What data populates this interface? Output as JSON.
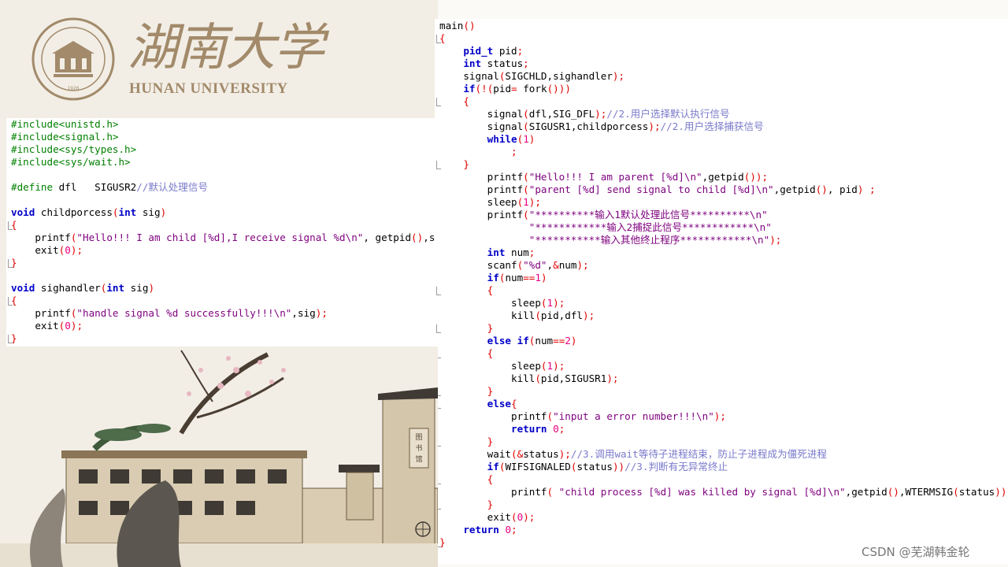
{
  "logo": {
    "chinese_name": "湖南大学",
    "english_name": "HUNAN UNIVERSITY"
  },
  "left_code": {
    "lines": [
      "#include<unistd.h>",
      "#include<signal.h>",
      "#include<sys/types.h>",
      "#include<sys/wait.h>",
      "",
      "#define dfl   SIGUSR2//默认处理信号",
      "",
      "void childporcess(int sig)",
      "{",
      "    printf(\"Hello!!! I am child [%d],I receive signal %d\\n\", getpid(),sig);",
      "    exit(0);",
      "}",
      "",
      "void sighandler(int sig)",
      "{",
      "    printf(\"handle signal %d successfully!!!\\n\",sig);",
      "    exit(0);",
      "}"
    ]
  },
  "right_code": {
    "lines": [
      "main()",
      "{",
      "    pid_t pid;",
      "    int status;",
      "    signal(SIGCHLD,sighandler);",
      "    if(!(pid= fork()))",
      "    {",
      "        signal(dfl,SIG_DFL);//2.用户选择默认执行信号",
      "        signal(SIGUSR1,childporcess);//2.用户选择捕获信号",
      "        while(1)",
      "            ;",
      "    }",
      "        printf(\"Hello!!! I am parent [%d]\\n\",getpid());",
      "        printf(\"parent [%d] send signal to child [%d]\\n\",getpid(), pid) ;",
      "        sleep(1);",
      "        printf(\"**********输入1默认处理此信号**********\\n\"",
      "               \"************输入2捕捉此信号************\\n\"",
      "               \"***********输入其他终止程序************\\n\");",
      "        int num;",
      "        scanf(\"%d\",&num);",
      "        if(num==1)",
      "        {",
      "            sleep(1);",
      "            kill(pid,dfl);",
      "        }",
      "        else if(num==2)",
      "        {",
      "            sleep(1);",
      "            kill(pid,SIGUSR1);",
      "        }",
      "        else{",
      "            printf(\"input a error number!!!\\n\");",
      "            return 0;",
      "        }",
      "        wait(&status);//3.调用wait等待子进程结束，防止子进程成为僵死进程",
      "        if(WIFSIGNALED(status))//3.判断有无异常终止",
      "        {",
      "            printf( \"child process [%d] was killed by signal [%d]\\n\",getpid(),WTERMSIG(status));",
      "        }",
      "        exit(0);",
      "    return 0;",
      "}"
    ]
  },
  "watermark": "CSDN @芜湖韩金轮",
  "colors": {
    "keyword": "#0000c8",
    "preprocessor": "#008000",
    "string": "#7e007e",
    "number": "#e6007e",
    "comment": "#7a7acc",
    "logo": "#a28a6a"
  }
}
